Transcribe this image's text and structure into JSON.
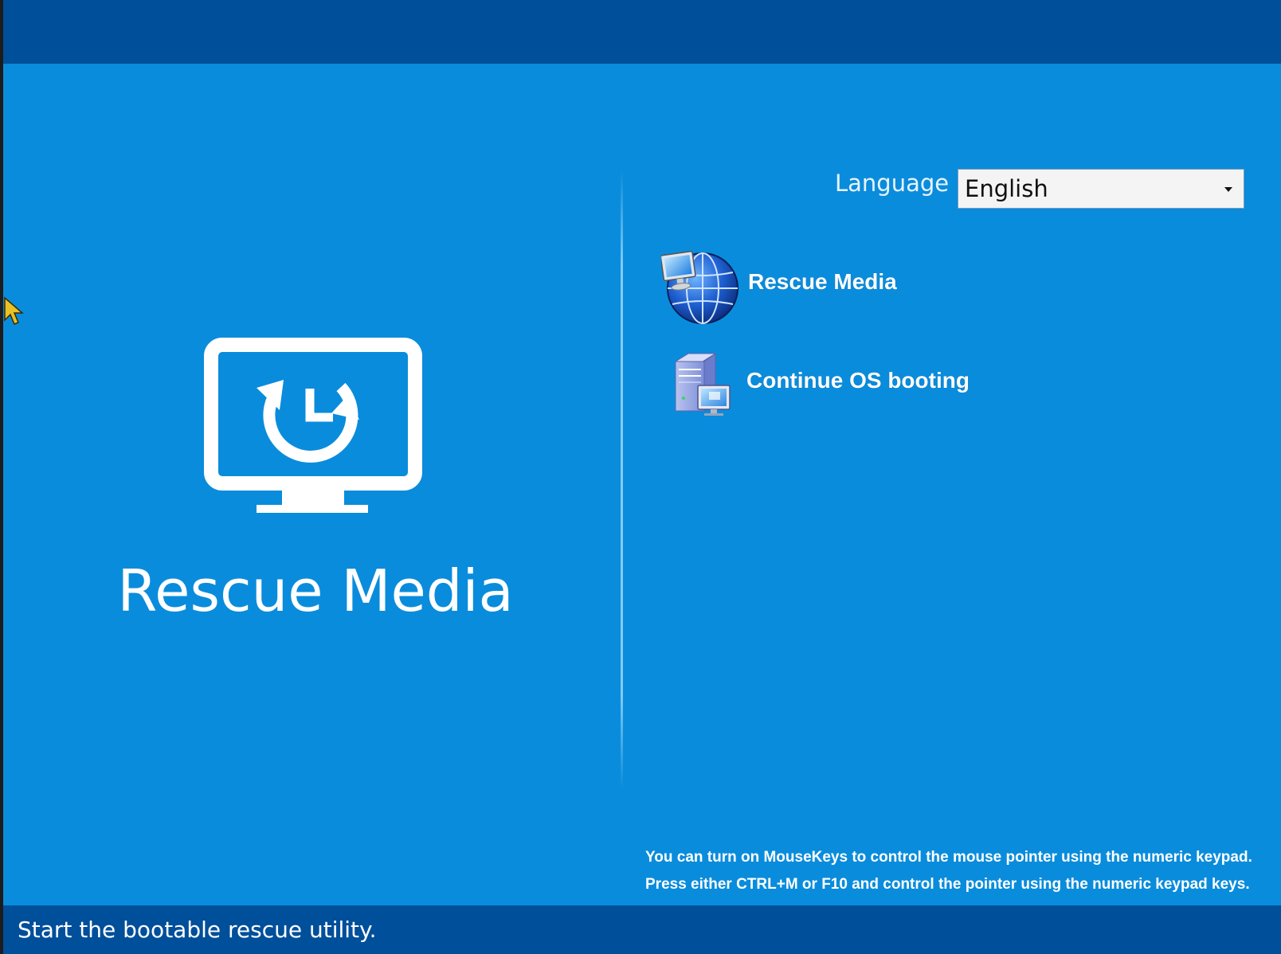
{
  "header": {},
  "hero": {
    "title": "Rescue Media",
    "icon": "monitor-restore-clock-icon"
  },
  "language": {
    "label": "Language",
    "selected": "English"
  },
  "menu": {
    "items": [
      {
        "label": "Rescue Media",
        "icon": "globe-computer-icon"
      },
      {
        "label": "Continue OS booting",
        "icon": "pc-tower-icon"
      }
    ]
  },
  "hint": {
    "line1": "You can turn on MouseKeys to control the mouse pointer using the numeric keypad.",
    "line2": "Press either CTRL+M or F10 and control the pointer using the numeric keypad keys."
  },
  "status": {
    "text": "Start the bootable rescue utility."
  },
  "colors": {
    "background": "#0a8cdc",
    "bar": "#004f9b",
    "text": "#ffffff"
  }
}
